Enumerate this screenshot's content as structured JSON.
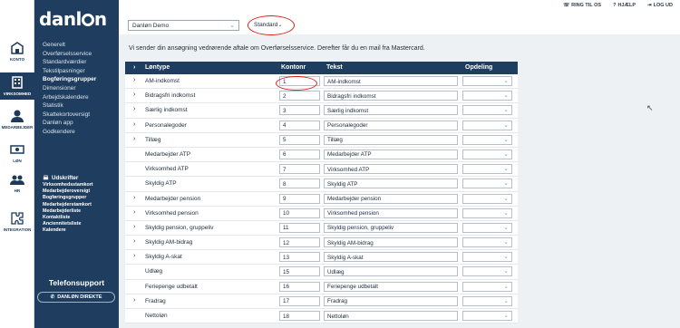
{
  "rail": [
    {
      "label": "KONTO",
      "icon": "building-icon"
    },
    {
      "label": "VIRKSOMHED",
      "icon": "office-icon"
    },
    {
      "label": "MEDARBEJDER",
      "icon": "person-icon"
    },
    {
      "label": "LØN",
      "icon": "money-icon"
    },
    {
      "label": "HR",
      "icon": "people-icon"
    },
    {
      "label": "INTEGRATION",
      "icon": "puzzle-icon"
    }
  ],
  "logo": {
    "pre": "danl",
    "post": "n"
  },
  "menu": [
    "Generelt",
    "Overførselsservice",
    "Standardværdier",
    "Tekstilpasninger",
    "Bogføringsgrupper",
    "Dimensioner",
    "Arbejdskalendere",
    "Statistik",
    "Skattekortoversigt",
    "Danløn app",
    "Godkendere"
  ],
  "udskrifter": {
    "title": "Udskrifter",
    "items": [
      "Virksomhedsstamkort",
      "Medarbejderoversigt",
      "Bogføringsgrupper",
      "Medarbejderstamkort",
      "Medarbejderliste",
      "Kontaktliste",
      "Anciennitetsliste",
      "Kalendere"
    ]
  },
  "phone": {
    "title": "Telefonsupport",
    "button": "DANLØN DIREKTE"
  },
  "top": {
    "company": "Danløn Demo",
    "standard": "Standard",
    "links": [
      "RING TIL OS",
      "HJÆLP",
      "LOG UD"
    ]
  },
  "info": "Vi sender din ansøgning vedrørende aftale om Overførselsservice. Derefter får du en mail fra Mastercard.",
  "table": {
    "headers": {
      "type": "Løntype",
      "konto": "Kontonr",
      "tekst": "Tekst",
      "opdeling": "Opdeling"
    },
    "rows": [
      {
        "arrow": true,
        "type": "AM-indkomst",
        "konto": "1",
        "tekst": "AM-indkomst"
      },
      {
        "arrow": true,
        "type": "Bidragsfri indkomst",
        "konto": "2",
        "tekst": "Bidragsfri indkomst"
      },
      {
        "arrow": true,
        "type": "Særlig indkomst",
        "konto": "3",
        "tekst": "Særlig indkomst"
      },
      {
        "arrow": true,
        "type": "Personalegoder",
        "konto": "4",
        "tekst": "Personalegoder"
      },
      {
        "arrow": true,
        "type": "Tillæg",
        "konto": "5",
        "tekst": "Tillæg"
      },
      {
        "arrow": false,
        "type": "Medarbejder ATP",
        "konto": "6",
        "tekst": "Medarbejder ATP"
      },
      {
        "arrow": false,
        "type": "Virksomhed ATP",
        "konto": "7",
        "tekst": "Virksomhed ATP"
      },
      {
        "arrow": false,
        "type": "Skyldig ATP",
        "konto": "8",
        "tekst": "Skyldig ATP"
      },
      {
        "arrow": true,
        "type": "Medarbejder pension",
        "konto": "9",
        "tekst": "Medarbejder pension"
      },
      {
        "arrow": true,
        "type": "Virksomhed pension",
        "konto": "10",
        "tekst": "Virksomhed pension"
      },
      {
        "arrow": true,
        "type": "Skyldig pension, gruppeliv",
        "konto": "11",
        "tekst": "Skyldig pension, gruppeliv"
      },
      {
        "arrow": true,
        "type": "Skyldig AM-bidrag",
        "konto": "12",
        "tekst": "Skyldig AM-bidrag"
      },
      {
        "arrow": true,
        "type": "Skyldig A-skat",
        "konto": "13",
        "tekst": "Skyldig A-skat"
      },
      {
        "arrow": false,
        "type": "Udlæg",
        "konto": "15",
        "tekst": "Udlæg"
      },
      {
        "arrow": false,
        "type": "Feriepenge udbetalt",
        "konto": "16",
        "tekst": "Feriepenge udbetalt"
      },
      {
        "arrow": true,
        "type": "Fradrag",
        "konto": "17",
        "tekst": "Fradrag"
      },
      {
        "arrow": false,
        "type": "Nettoløn",
        "konto": "18",
        "tekst": "Nettoløn"
      }
    ]
  },
  "colors": {
    "sidebar": "#1f3e5f",
    "highlight": "#d8231a",
    "accent": "#5aa2b0"
  }
}
